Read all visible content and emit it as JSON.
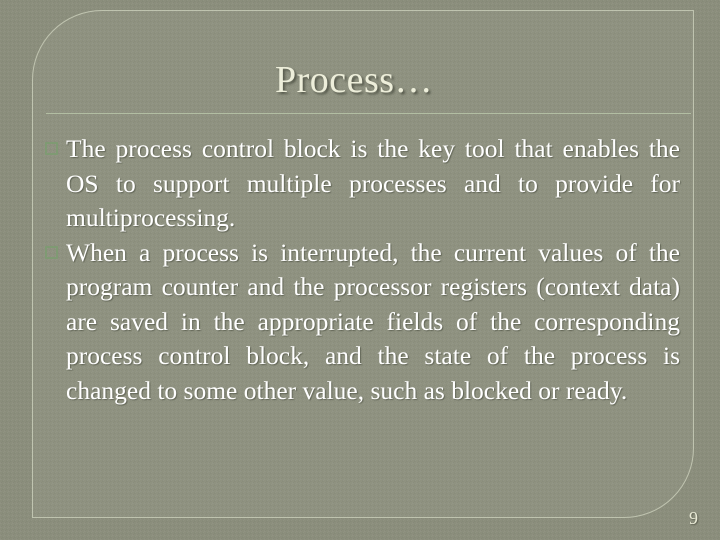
{
  "slide": {
    "title": "Process…",
    "slide_number": "9",
    "bullets": [
      {
        "marker": "hollow-square-bullet",
        "text": "The process control block is the key tool that enables the OS to support multiple processes and to provide for multiprocessing."
      },
      {
        "marker": "hollow-square-bullet",
        "text": "When a process is interrupted, the current values of the program counter and the processor registers (context data) are saved in the appropriate fields of the corresponding process control block, and the state of the process is changed to some other value, such as blocked or ready."
      }
    ],
    "colors": {
      "background": "#8b8e7c",
      "title_text": "#edeeda",
      "body_text": "#ffffff",
      "bullet_marker": "#7f9a73",
      "rule": "#b9c6a9",
      "frame_line": "#e2e6d0"
    }
  }
}
